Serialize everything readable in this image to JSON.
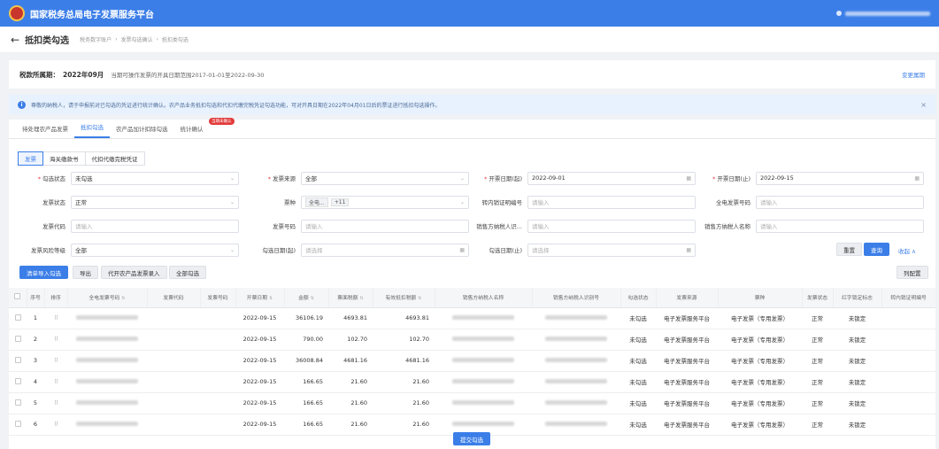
{
  "app": {
    "title": "国家税务总局电子发票服务平台"
  },
  "header": {
    "page_title": "抵扣类勾选",
    "breadcrumbs": [
      "税务数字账户",
      "发票勾选确认",
      "抵扣类勾选"
    ]
  },
  "period": {
    "label": "税款所属期：",
    "value": "2022年09月",
    "desc": "当期可操作发票的开具日期范围2017-01-01至2022-09-30",
    "link": "变更属期"
  },
  "notice": {
    "text": "尊敬的纳税人，请于申报前对已勾选的凭证进行统计确认。农产品业务抵扣勾选和代扣代缴完税凭证勾选功能，可对开具日期在2022年04月01日后的票证进行抵扣勾选操作。",
    "close": "×"
  },
  "tabs": [
    {
      "label": "待处理农产品发票"
    },
    {
      "label": "抵扣勾选"
    },
    {
      "label": "农产品加计扣除勾选"
    },
    {
      "label": "统计确认",
      "badge": "当期未确认"
    }
  ],
  "subtabs": [
    "发票",
    "海关缴款书",
    "代扣代缴完税凭证"
  ],
  "filters": {
    "check_status": {
      "label": "勾选状态",
      "value": "未勾选"
    },
    "invoice_source": {
      "label": "发票来源",
      "value": "全部"
    },
    "issue_date_start": {
      "label": "开票日期(起)",
      "value": "2022-09-01"
    },
    "issue_date_end": {
      "label": "开票日期(止)",
      "value": "2022-09-15"
    },
    "invoice_status": {
      "label": "发票状态",
      "value": "正常"
    },
    "ticket_type": {
      "label": "票种",
      "chip1": "全电...",
      "chip2": "+11"
    },
    "transfer_no": {
      "label": "转内销证明编号",
      "placeholder": "请输入"
    },
    "full_invoice_no": {
      "label": "全电发票号码",
      "placeholder": "请输入"
    },
    "invoice_code": {
      "label": "发票代码",
      "placeholder": "请输入"
    },
    "invoice_no": {
      "label": "发票号码",
      "placeholder": "请输入"
    },
    "seller_tax_id": {
      "label": "销售方纳税人识...",
      "placeholder": "请输入"
    },
    "seller_name": {
      "label": "销售方纳税人名称",
      "placeholder": "请输入"
    },
    "risk_level": {
      "label": "发票风险等级",
      "value": "全部"
    },
    "check_date_start": {
      "label": "勾选日期(起)",
      "placeholder": "请选择"
    },
    "check_date_end": {
      "label": "勾选日期(止)",
      "placeholder": "请选择"
    }
  },
  "buttons": {
    "reset": "重置",
    "query": "查询",
    "collapse": "收起 ∧",
    "bulk_import": "清单导入勾选",
    "export": "导出",
    "agri_import": "代开农产品发票录入",
    "select_all": "全部勾选",
    "columns": "列配置",
    "submit": "提交勾选"
  },
  "table": {
    "columns": [
      "序号",
      "排序",
      "全电发票号码",
      "发票代码",
      "发票号码",
      "开票日期",
      "金额",
      "票面税额",
      "有效抵扣税额",
      "销售方纳税人名称",
      "销售方纳税人识别号",
      "勾选状态",
      "发票来源",
      "票种",
      "发票状态",
      "红字锁定标志",
      "转内销证明编号"
    ],
    "rows": [
      {
        "no": "1",
        "date": "2022-09-15",
        "amount": "36106.19",
        "tax": "4693.81",
        "valid_tax": "4693.81",
        "check_status": "未勾选",
        "source": "电子发票服务平台",
        "type": "电子发票（专用发票）",
        "status": "正常",
        "red_lock": "未锁定"
      },
      {
        "no": "2",
        "date": "2022-09-15",
        "amount": "790.00",
        "tax": "102.70",
        "valid_tax": "102.70",
        "check_status": "未勾选",
        "source": "电子发票服务平台",
        "type": "电子发票（专用发票）",
        "status": "正常",
        "red_lock": "未锁定"
      },
      {
        "no": "3",
        "date": "2022-09-15",
        "amount": "36008.84",
        "tax": "4681.16",
        "valid_tax": "4681.16",
        "check_status": "未勾选",
        "source": "电子发票服务平台",
        "type": "电子发票（专用发票）",
        "status": "正常",
        "red_lock": "未锁定"
      },
      {
        "no": "4",
        "date": "2022-09-15",
        "amount": "166.65",
        "tax": "21.60",
        "valid_tax": "21.60",
        "check_status": "未勾选",
        "source": "电子发票服务平台",
        "type": "电子发票（专用发票）",
        "status": "正常",
        "red_lock": "未锁定"
      },
      {
        "no": "5",
        "date": "2022-09-15",
        "amount": "166.65",
        "tax": "21.60",
        "valid_tax": "21.60",
        "check_status": "未勾选",
        "source": "电子发票服务平台",
        "type": "电子发票（专用发票）",
        "status": "正常",
        "red_lock": "未锁定"
      },
      {
        "no": "6",
        "date": "2022-09-15",
        "amount": "166.65",
        "tax": "21.60",
        "valid_tax": "21.60",
        "check_status": "未勾选",
        "source": "电子发票服务平台",
        "type": "电子发票（专用发票）",
        "status": "正常",
        "red_lock": "未锁定"
      }
    ]
  },
  "colors": {
    "primary": "#3b7ee8",
    "badge": "#e23b3b",
    "notice_bg": "#e8f2ff"
  },
  "icons": {
    "back": "arrow-left-icon",
    "info": "info-circle-icon",
    "calendar": "calendar-icon",
    "chevron": "chevron-down-icon",
    "drag": "drag-handle-icon",
    "sort": "sort-icon"
  }
}
